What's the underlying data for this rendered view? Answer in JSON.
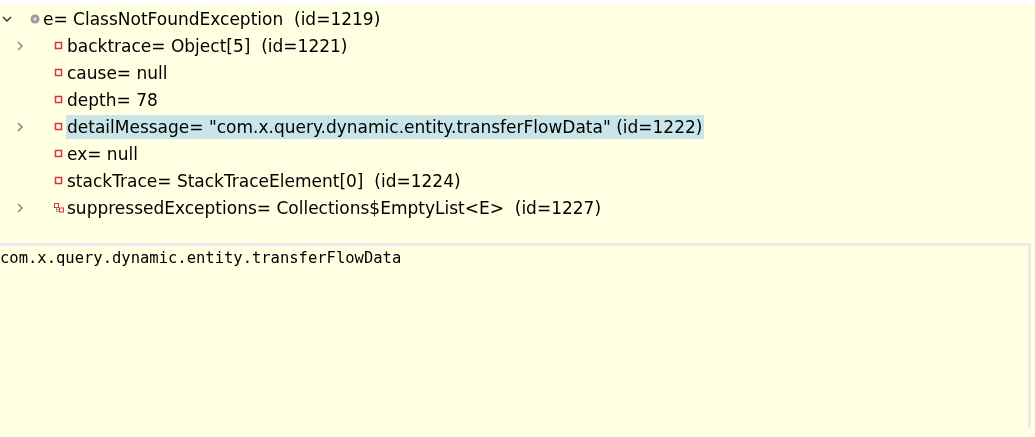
{
  "variables_tree": [
    {
      "label": "e= ClassNotFoundException  (id=1219)",
      "kind": "object",
      "expanded": true,
      "selected": false,
      "children": [
        {
          "label": "backtrace= Object[5]  (id=1221)",
          "kind": "field",
          "expanded": false,
          "selected": false
        },
        {
          "label": "cause= null",
          "kind": "field",
          "selected": false
        },
        {
          "label": "depth= 78",
          "kind": "field",
          "selected": false
        },
        {
          "label": "detailMessage= \"com.x.query.dynamic.entity.transferFlowData\" (id=1222)",
          "kind": "field",
          "expanded": false,
          "selected": true
        },
        {
          "label": "ex= null",
          "kind": "field",
          "selected": false
        },
        {
          "label": "stackTrace= StackTraceElement[0]  (id=1224)",
          "kind": "field",
          "selected": false
        },
        {
          "label": "suppressedExceptions= Collections$EmptyList<E>  (id=1227)",
          "kind": "collection",
          "expanded": false,
          "selected": false
        }
      ]
    }
  ],
  "detail_pane": {
    "text": "com.x.query.dynamic.entity.transferFlowData"
  }
}
